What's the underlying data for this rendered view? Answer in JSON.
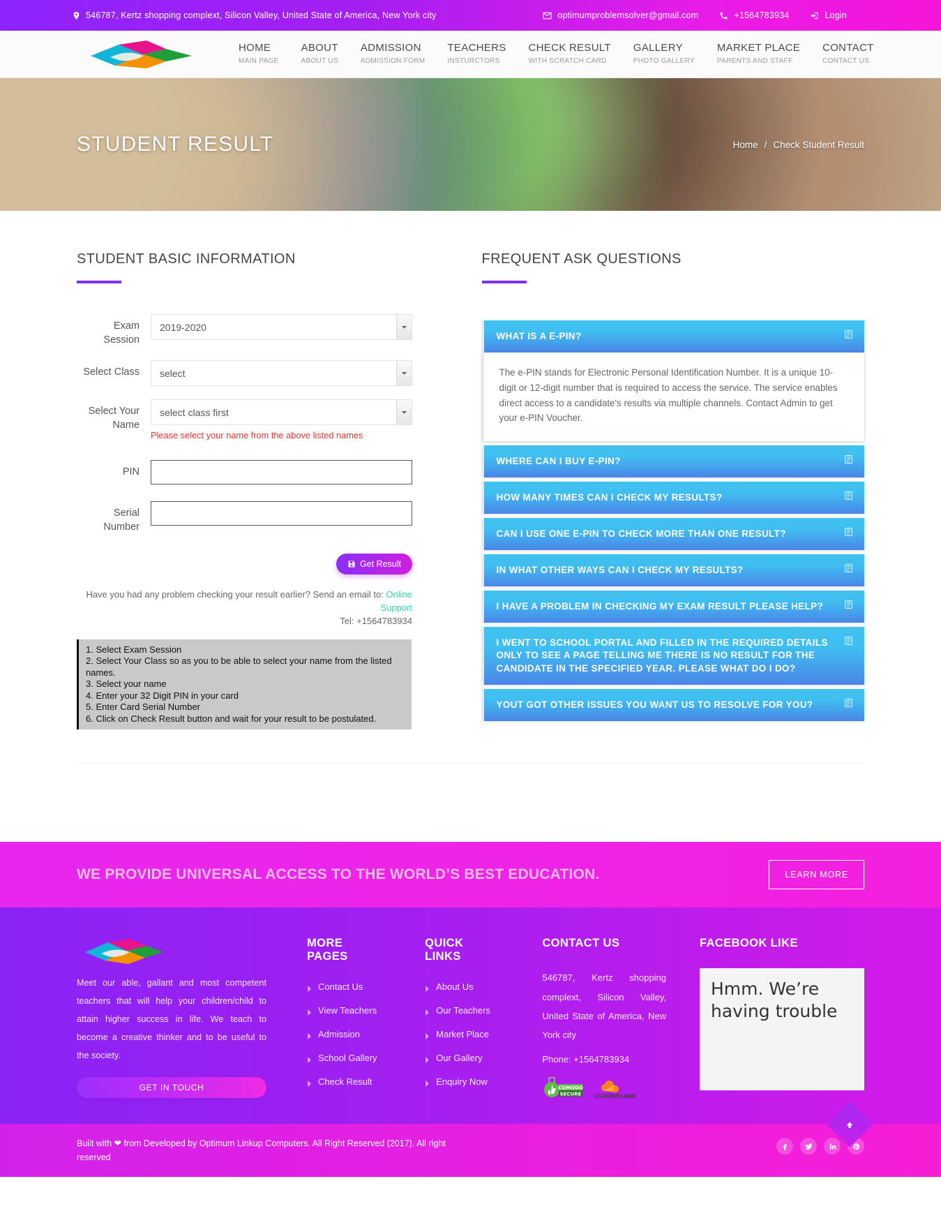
{
  "topbar": {
    "address": "546787, Kertz shopping complext, Silicon Valley, United State of America, New York city",
    "email": "optimumproblemsolver@gmail.com",
    "phone": "+1564783934",
    "login": "Login"
  },
  "nav": {
    "items": [
      {
        "main": "HOME",
        "sub": "MAIN PAGE"
      },
      {
        "main": "ABOUT",
        "sub": "ABOUT US"
      },
      {
        "main": "ADMISSION",
        "sub": "ADMISSION FORM"
      },
      {
        "main": "TEACHERS",
        "sub": "INSTURCTORS"
      },
      {
        "main": "CHECK RESULT",
        "sub": "WITH SCRATCH CARD"
      },
      {
        "main": "GALLERY",
        "sub": "PHOTO GALLERY"
      },
      {
        "main": "MARKET PLACE",
        "sub": "PARENTS AND STAFF"
      },
      {
        "main": "CONTACT",
        "sub": "CONTACT US"
      }
    ]
  },
  "hero": {
    "title": "STUDENT RESULT",
    "crumb_home": "Home",
    "crumb_sep": "/",
    "crumb_current": "Check Student Result"
  },
  "form_section": {
    "title": "STUDENT BASIC INFORMATION",
    "fields": {
      "exam_session_label": "Exam Session",
      "exam_session_value": "2019-2020",
      "select_class_label": "Select Class",
      "select_class_value": "select",
      "select_name_label": "Select Your Name",
      "select_name_value": "select class first",
      "select_name_error": "Please select your name from the above listed names",
      "pin_label": "PIN",
      "pin_value": "",
      "serial_label": "Serial Number",
      "serial_value": ""
    },
    "submit_label": "Get Result",
    "help_line1": "Have you had any problem checking your result earlier? Send an email to:",
    "help_link": "Online Support",
    "help_tel": "Tel: +1564783934",
    "steps": [
      "1. Select Exam Session",
      "2. Select Your Class so as you to be able to select your name from the listed names.",
      "3. Select your name",
      "4. Enter your 32 Digit PIN in your card",
      "5. Enter Card Serial Number",
      "6. Click on Check Result button and wait for your result to be postulated."
    ]
  },
  "faq_section": {
    "title": "FREQUENT ASK QUESTIONS",
    "items": [
      {
        "question": "WHAT IS A E-PIN?",
        "answer": "The e-PIN stands for Electronic Personal Identification Number. It is a unique 10-digit or 12-digit number that is required to access the service. The service enables direct access to a candidate's results via multiple channels. Contact Admin to get your e-PIN Voucher.",
        "open": true
      },
      {
        "question": "WHERE CAN I BUY E-PIN?",
        "answer": "",
        "open": false
      },
      {
        "question": "HOW MANY TIMES CAN I CHECK MY RESULTS?",
        "answer": "",
        "open": false
      },
      {
        "question": "CAN I USE ONE E-PIN TO CHECK MORE THAN ONE RESULT?",
        "answer": "",
        "open": false
      },
      {
        "question": "IN WHAT OTHER WAYS CAN I CHECK MY RESULTS?",
        "answer": "",
        "open": false
      },
      {
        "question": "I HAVE A PROBLEM IN CHECKING MY EXAM RESULT PLEASE HELP?",
        "answer": "",
        "open": false
      },
      {
        "question": "I WENT TO SCHOOL PORTAL AND FILLED IN THE REQUIRED DETAILS ONLY TO SEE A PAGE TELLING ME THERE IS NO RESULT FOR THE CANDIDATE IN THE SPECIFIED YEAR. PLEASE WHAT DO I DO?",
        "answer": "",
        "open": false
      },
      {
        "question": "YOUT GOT OTHER ISSUES YOU WANT US TO RESOLVE FOR YOU?",
        "answer": "",
        "open": false
      }
    ]
  },
  "cta": {
    "text_main": "WE PROVIDE UNIVERSAL ACCESS TO THE WORLD’S BEST ",
    "text_accent": "EDUCATION.",
    "button": "LEARN MORE"
  },
  "footer": {
    "about_text": "Meet our able, gallant and most competent teachers that will help your children/child to attain higher success in life. We teach to become a creative thinker and to be useful to the society.",
    "get_in_touch": "GET IN TOUCH",
    "more_pages_title": "MORE PAGES",
    "more_pages": [
      "Contact Us",
      "View Teachers",
      "Admission",
      "School Gallery",
      "Check Result"
    ],
    "quick_links_title": "QUICK LINKS",
    "quick_links": [
      "About Us",
      "Our Teachers",
      "Market Place",
      "Our Gallery",
      "Enquiry Now"
    ],
    "contact_title": "CONTACT US",
    "contact_address": "546787, Kertz shopping complext, Silicon Valley, United State of America, New York city",
    "contact_phone": "Phone: +1564783934",
    "badge_comodo": "COMODO SECURE",
    "badge_cloudflare": "CLOUDFLARE",
    "facebook_title": "FACEBOOK LIKE",
    "facebook_placeholder": "Hmm. We’re having trouble"
  },
  "bottombar": {
    "credit": "Built with ❤ from Developed by Optimum Linkup Computers. All Right Reserved (2017). All right reserved",
    "socials": [
      "facebook-icon",
      "twitter-icon",
      "linkedin-icon",
      "pinterest-icon"
    ]
  },
  "colors": {
    "accent_purple": "#7b2ff7",
    "accent_magenta": "#ef1fe0",
    "faq_blue_top": "#41c3ef",
    "faq_blue_bottom": "#4a86e8",
    "error_red": "#e8332a",
    "link_green": "#33d6a6"
  }
}
